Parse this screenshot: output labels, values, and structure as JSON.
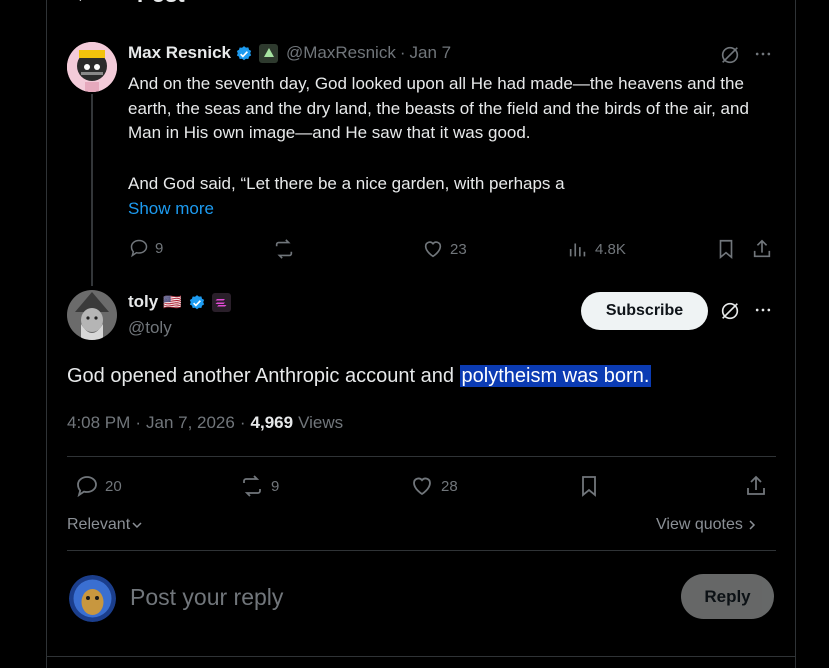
{
  "header": {
    "back_glyph": "←",
    "title": "Post"
  },
  "parent_post": {
    "display_name": "Max Resnick",
    "handle": "@MaxResnick",
    "separator": "·",
    "date": "Jan 7",
    "text_para1": "And on the seventh day, God looked upon all He had made—the heavens and the earth, the seas and the dry land, the beasts of the field and the birds of the air, and Man in His own image—and He saw that it was good.",
    "text_para2": "And God said, “Let there be a nice garden, with perhaps a",
    "show_more": "Show more",
    "replies": "9",
    "reposts": "",
    "likes": "23",
    "views": "4.8K"
  },
  "main_post": {
    "display_name": "toly",
    "flag": "🇺🇸",
    "handle": "@toly",
    "subscribe_label": "Subscribe",
    "text_plain": "God opened another Anthropic account and ",
    "text_highlight": "polytheism was born.",
    "time": "4:08 PM",
    "separator": "·",
    "date": "Jan 7, 2026",
    "view_count": "4,969",
    "views_label": "Views",
    "replies": "20",
    "reposts": "9",
    "likes": "28"
  },
  "filters": {
    "sort_label": "Relevant",
    "view_quotes": "View quotes"
  },
  "composer": {
    "placeholder": "Post your reply",
    "reply_label": "Reply"
  },
  "colors": {
    "accent": "#1d9bf0",
    "highlight": "#0b3bb3",
    "muted": "#71767b"
  }
}
